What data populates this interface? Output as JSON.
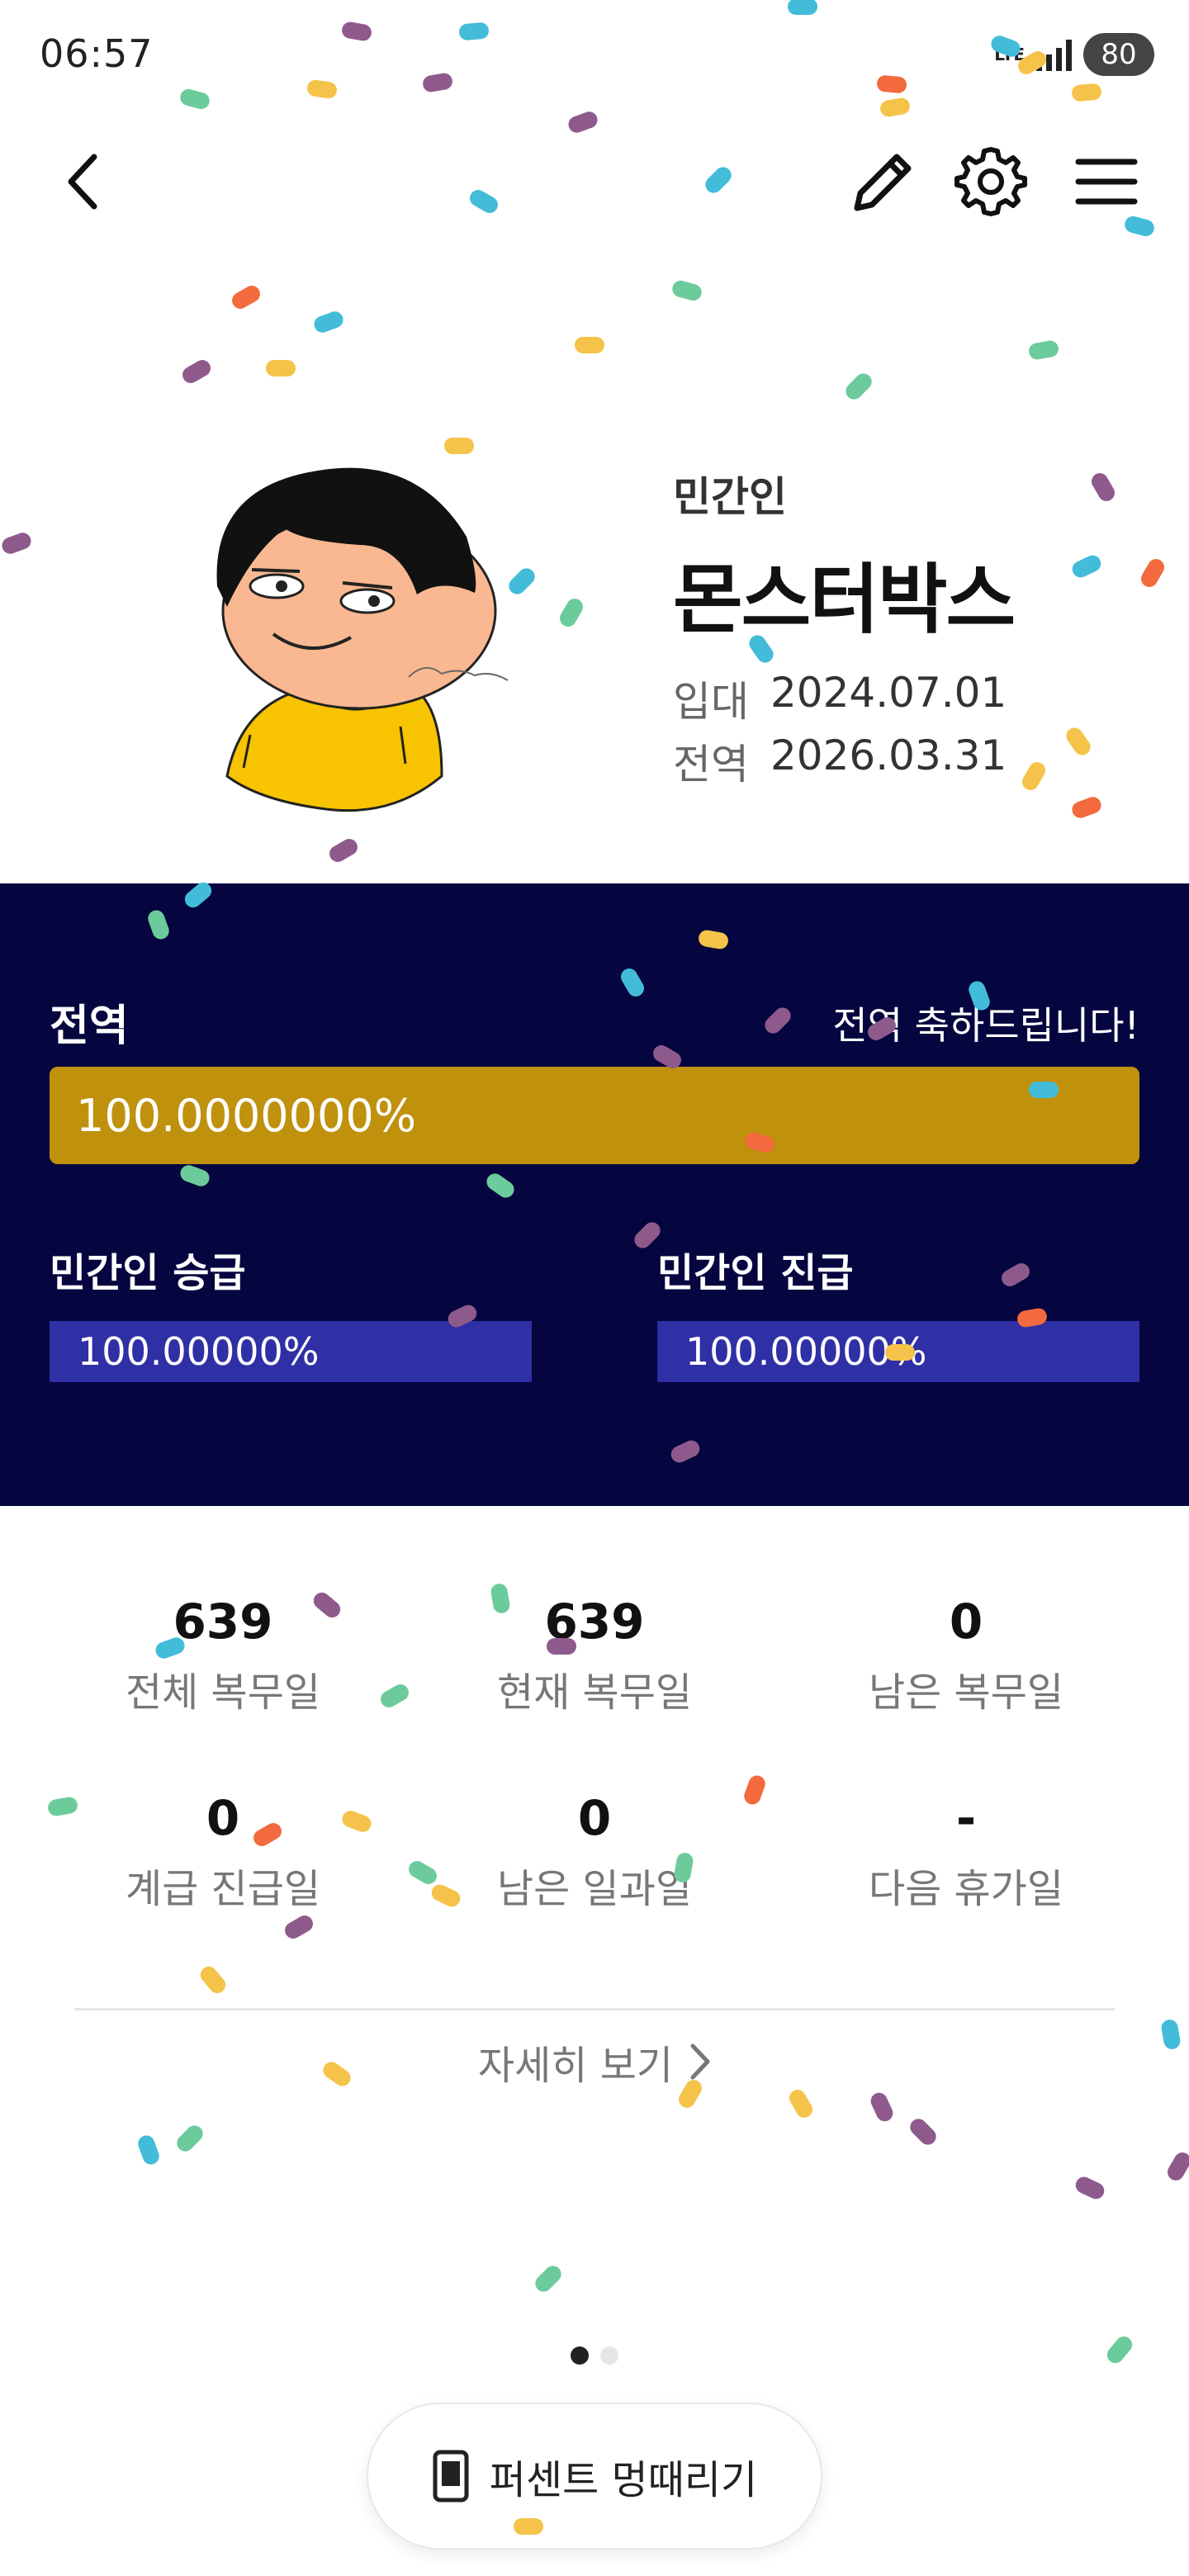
{
  "status_bar": {
    "time": "06:57",
    "network": "LTE",
    "battery": "80"
  },
  "app_bar": {
    "back_icon": "chevron-left-icon",
    "edit_icon": "pencil-icon",
    "settings_icon": "gear-icon",
    "menu_icon": "hamburger-menu-icon"
  },
  "profile": {
    "rank": "민간인",
    "name": "몬스터박스",
    "enlist_label": "입대",
    "enlist_date": "2024.07.01",
    "discharge_label": "전역",
    "discharge_date": "2026.03.31"
  },
  "progress": {
    "title": "전역",
    "message": "전역 축하드립니다!",
    "value_text": "100.0000000%",
    "value": 100,
    "promotion": {
      "title": "민간인 승급",
      "value_text": "100.00000%",
      "value": 100
    },
    "pay_grade": {
      "title": "민간인 진급",
      "value_text": "100.00000%",
      "value": 100
    }
  },
  "stats": [
    {
      "value": "639",
      "label": "전체 복무일"
    },
    {
      "value": "639",
      "label": "현재 복무일"
    },
    {
      "value": "0",
      "label": "남은 복무일"
    },
    {
      "value": "0",
      "label": "계급 진급일"
    },
    {
      "value": "0",
      "label": "남은 일과일"
    },
    {
      "value": "-",
      "label": "다음 휴가일"
    }
  ],
  "more_link": "자세히 보기",
  "pager": {
    "count": 2,
    "active": 0
  },
  "fab": {
    "label": "퍼센트 멍때리기",
    "icon": "phone-icon"
  },
  "colors": {
    "panel_bg": "#05053f",
    "main_bar": "#bf910c",
    "sub_bar": "#2c2c9e",
    "confetti": [
      "#8e5a8c",
      "#f5c34a",
      "#42bcd9",
      "#6ccb9b",
      "#f26a3d"
    ]
  }
}
